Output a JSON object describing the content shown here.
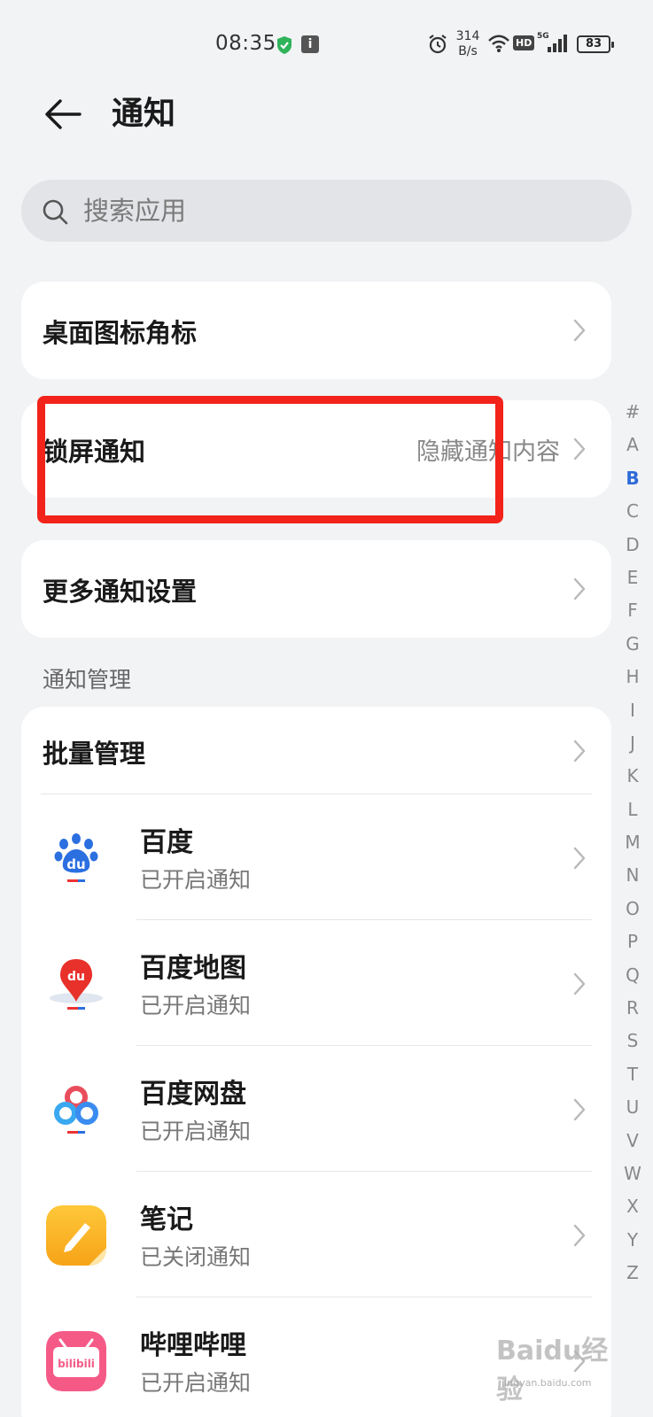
{
  "status_bar": {
    "time": "08:35",
    "net_speed_value": "314",
    "net_speed_unit": "B/s",
    "hd_label": "HD",
    "network_label": "5G",
    "battery": "83",
    "info_label": "i"
  },
  "header": {
    "title": "通知",
    "back_icon": "arrow-left-icon"
  },
  "search": {
    "placeholder": "搜索应用",
    "value": ""
  },
  "settings": [
    {
      "label": "桌面图标角标",
      "value": ""
    },
    {
      "label": "锁屏通知",
      "value": "隐藏通知内容"
    },
    {
      "label": "更多通知设置",
      "value": ""
    }
  ],
  "section_title": "通知管理",
  "batch": {
    "label": "批量管理"
  },
  "apps": [
    {
      "name": "百度",
      "status": "已开启通知",
      "icon": "baidu-icon"
    },
    {
      "name": "百度地图",
      "status": "已开启通知",
      "icon": "baidu-map-icon"
    },
    {
      "name": "百度网盘",
      "status": "已开启通知",
      "icon": "baidu-netdisk-icon"
    },
    {
      "name": "笔记",
      "status": "已关闭通知",
      "icon": "notes-icon"
    },
    {
      "name": "哔哩哔哩",
      "status": "已开启通知",
      "icon": "bilibili-icon"
    }
  ],
  "alphabet": [
    "#",
    "A",
    "B",
    "C",
    "D",
    "E",
    "F",
    "G",
    "H",
    "I",
    "J",
    "K",
    "L",
    "M",
    "N",
    "O",
    "P",
    "Q",
    "R",
    "S",
    "T",
    "U",
    "V",
    "W",
    "X",
    "Y",
    "Z"
  ],
  "alphabet_active": "B",
  "brand_labels": {
    "baidu_logo": "du",
    "bilibili_logo": "bilibili"
  },
  "watermark": {
    "main": "Baidu经验",
    "sub": "jingyan.baidu.com"
  },
  "colors": {
    "background": "#f1f3f5",
    "card": "#ffffff",
    "accent": "#2e6ad8",
    "highlight": "#f2231b"
  }
}
